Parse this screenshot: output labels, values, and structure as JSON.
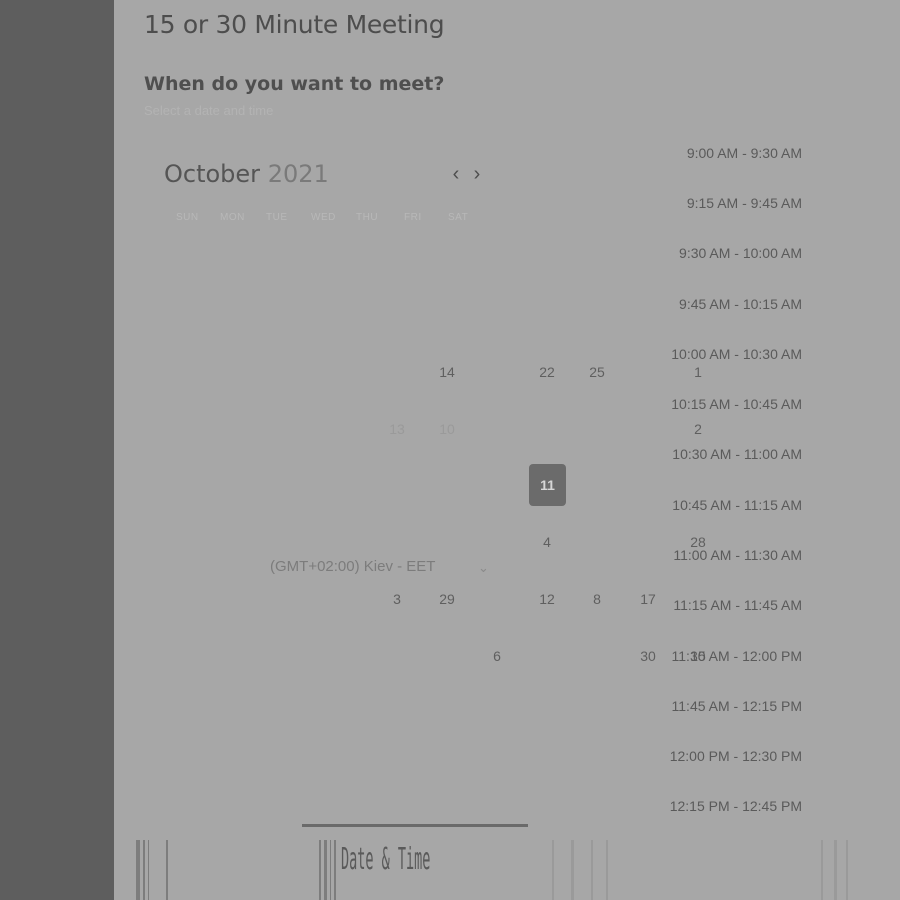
{
  "meeting": {
    "title": "15 or 30 Minute Meeting",
    "question": "When do you want to meet?",
    "subtitle": "Select a date and time"
  },
  "calendar": {
    "month": "October",
    "year": "2021",
    "prev_icon": "chevron-left-icon",
    "next_icon": "chevron-right-icon",
    "weekdays": [
      "SUN",
      "MON",
      "TUE",
      "WED",
      "THU",
      "FRI",
      "SAT"
    ],
    "visible_days": [
      "14",
      "22",
      "25",
      "1",
      "13",
      "10",
      "2",
      "11",
      "4",
      "28",
      "3",
      "29",
      "12",
      "8",
      "17",
      "6",
      "30",
      "15"
    ],
    "selected_day": "11"
  },
  "timezone": {
    "label": "(GMT+02:00) Kiev - EET",
    "icon": "chevron-down-icon"
  },
  "time_slots": [
    "9:00 AM - 9:30 AM",
    "9:15 AM - 9:45 AM",
    "9:30 AM - 10:00 AM",
    "9:45 AM - 10:15 AM",
    "10:00 AM - 10:30 AM",
    "10:15 AM - 10:45 AM",
    "10:30 AM - 11:00 AM",
    "10:45 AM - 11:15 AM",
    "11:00 AM - 11:30 AM",
    "11:15 AM - 11:45 AM",
    "11:30 AM - 12:00 PM",
    "11:45 AM - 12:15 PM",
    "12:00 PM - 12:30 PM",
    "12:15 PM - 12:45 PM"
  ],
  "stepper": {
    "step_1": "",
    "step_2": "Date & Time"
  },
  "colors": {
    "overlay": "#a7a7a7",
    "sidebar": "#5e5e5e",
    "selected_day": "#6b6b6b"
  }
}
